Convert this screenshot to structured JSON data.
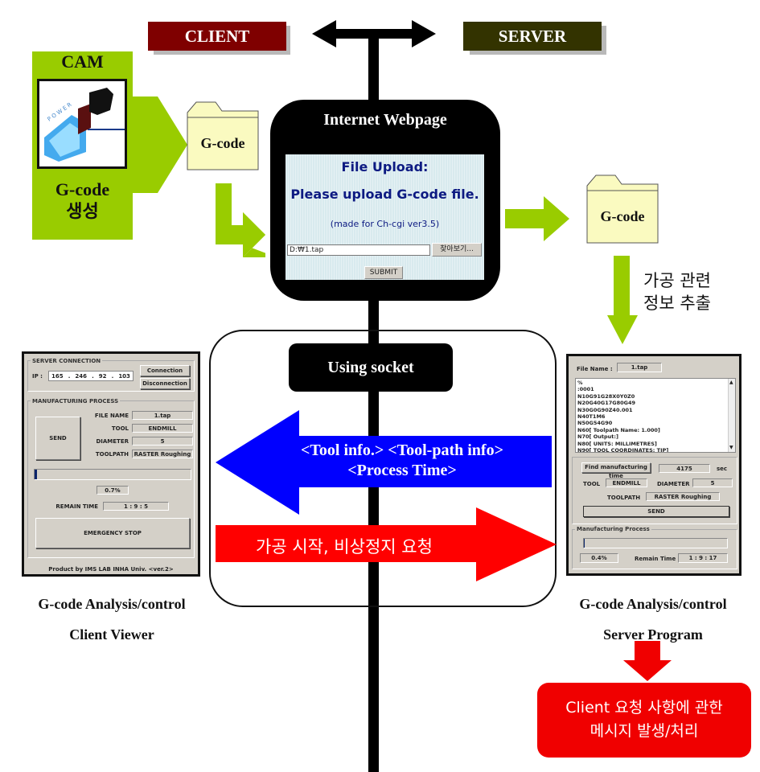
{
  "header": {
    "client_label": "CLIENT",
    "server_label": "SERVER",
    "client_color": "#7f0000",
    "server_color": "#333300"
  },
  "cam": {
    "title": "CAM",
    "logo_icon": "powermill-logo",
    "caption_line1": "G-code",
    "caption_line2": "생성",
    "color": "#99cc00"
  },
  "folders": {
    "client_file_label": "G-code",
    "server_file_label": "G-code",
    "color": "#fafac0"
  },
  "webpage": {
    "title": "Internet Webpage",
    "upload_heading": "File Upload:",
    "upload_prompt": "Please upload G-code file.",
    "upload_note": "(made for Ch-cgi ver3.5)",
    "file_path_value": "D:₩1.tap",
    "browse_label": "찾아보기...",
    "submit_label": "SUBMIT"
  },
  "extract_label": {
    "line1": "가공 관련",
    "line2": "정보 추출"
  },
  "socket": {
    "label": "Using socket",
    "server_to_client_line1": "<Tool info.> <Tool-path info>",
    "server_to_client_line2": "<Process Time>",
    "server_to_client_color": "#0000ff",
    "client_to_server": "가공 시작, 비상정지 요청",
    "client_to_server_color": "#ff0000"
  },
  "client_viewer": {
    "server_connection_title": "SERVER CONNECTION",
    "ip_label": "IP :",
    "ip_octets": [
      "165",
      "246",
      "92",
      "103"
    ],
    "connection_button": "Connection",
    "disconnection_button": "Disconnection",
    "process_title": "MANUFACTURING PROCESS",
    "send_button": "SEND",
    "fields": [
      {
        "label": "FILE NAME",
        "value": "1.tap"
      },
      {
        "label": "TOOL",
        "value": "ENDMILL"
      },
      {
        "label": "DIAMETER",
        "value": "5"
      },
      {
        "label": "TOOLPATH",
        "value": "RASTER Roughing"
      }
    ],
    "progress_percent": 0.7,
    "progress_text": "0.7%",
    "remain_time_label": "REMAIN TIME",
    "remain_time_value": "1 : 9 : 5",
    "emergency_button": "EMERGENCY STOP",
    "footer": "Product by IMS LAB INHA Univ. <ver.2>",
    "caption_line1": "G-code Analysis/control",
    "caption_line2": "Client Viewer"
  },
  "server_program": {
    "file_name_label": "File Name :",
    "file_name_value": "1.tap",
    "code_lines": [
      "%",
      ":0001",
      "N10G91G28X0Y0Z0",
      "N20G40G17G80G49",
      "N30G0G90Z40.001",
      "N40T1M6",
      "N50G54G90",
      "N60[ Toolpath Name:   1.000]",
      "N70[ Output:]",
      "N80[ UNITS: MILLIMETRES]",
      "N90[ TOOL COORDINATES: TIP]"
    ],
    "find_time_button": "Find manufacturing time",
    "time_value": "4175",
    "time_unit": "sec",
    "tool_label": "TOOL",
    "tool_value": "ENDMILL",
    "diameter_label": "DIAMETER",
    "diameter_value": "5",
    "toolpath_label": "TOOLPATH",
    "toolpath_value": "RASTER Roughing",
    "send_button": "SEND",
    "process_title": "Manufacturing Process",
    "progress_percent": 0.4,
    "progress_text": "0.4%",
    "remain_time_label": "Remain Time :",
    "remain_time_value": "1 : 9 : 17",
    "caption_line1": "G-code Analysis/control",
    "caption_line2": "Server Program"
  },
  "result": {
    "line1": "Client 요청 사항에 관한",
    "line2": "메시지 발생/처리",
    "color": "#f00000"
  }
}
